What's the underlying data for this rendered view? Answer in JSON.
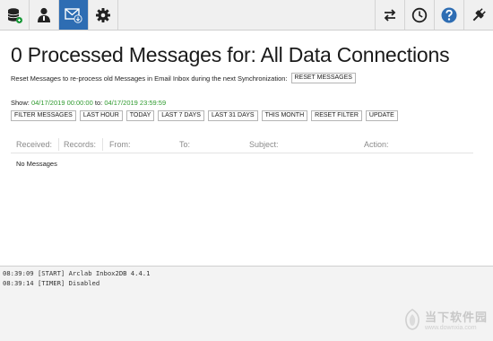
{
  "toolbar": {
    "left_icons": [
      "database-sync-icon",
      "user-icon",
      "mail-download-icon",
      "gear-icon"
    ],
    "active_index": 2,
    "right_icons": [
      "sync-arrows-icon",
      "clock-icon",
      "help-icon",
      "plug-icon"
    ],
    "active_color": "#2e6db3",
    "help_color": "#2e6db3"
  },
  "main": {
    "title": "0 Processed Messages for: All Data Connections",
    "reset_text": "Reset Messages to re-process old Messages in Email Inbox during the next Synchronization:",
    "reset_button": "RESET MESSAGES",
    "show_label": "Show:",
    "date_from": "04/17/2019 00:00:00",
    "to_label": "to:",
    "date_to": "04/17/2019 23:59:59",
    "date_color": "#2e9a2e",
    "filters": [
      "FILTER MESSAGES",
      "LAST HOUR",
      "TODAY",
      "LAST 7 DAYS",
      "LAST 31 DAYS",
      "THIS MONTH",
      "RESET FILTER",
      "UPDATE"
    ],
    "columns": [
      "Received:",
      "Records:",
      "From:",
      "To:",
      "Subject:",
      "Action:"
    ],
    "empty_text": "No Messages"
  },
  "log": {
    "lines": [
      "08:39:09 [START] Arclab Inbox2DB 4.4.1",
      "08:39:14 [TIMER] Disabled"
    ]
  },
  "watermark": {
    "main": "当下软件园",
    "sub": "www.downxia.com"
  }
}
